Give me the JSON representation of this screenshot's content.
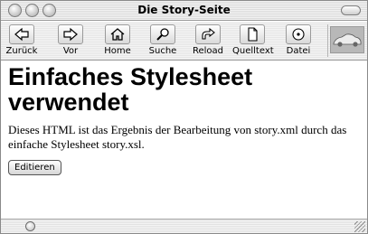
{
  "window": {
    "title": "Die Story-Seite"
  },
  "toolbar": {
    "buttons": [
      {
        "label": "Zurück",
        "icon": "arrow-left-icon"
      },
      {
        "label": "Vor",
        "icon": "arrow-right-icon"
      },
      {
        "label": "Home",
        "icon": "home-icon"
      },
      {
        "label": "Suche",
        "icon": "search-icon"
      },
      {
        "label": "Reload",
        "icon": "reload-icon"
      },
      {
        "label": "Quelltext",
        "icon": "page-icon"
      },
      {
        "label": "Datei",
        "icon": "disc-icon"
      }
    ]
  },
  "content": {
    "heading": "Einfaches Stylesheet verwendet",
    "paragraph": "Dieses HTML ist das Ergebnis der Bearbeitung von story.xml durch das einfache Stylesheet story.xsl.",
    "edit_button": "Editieren"
  }
}
